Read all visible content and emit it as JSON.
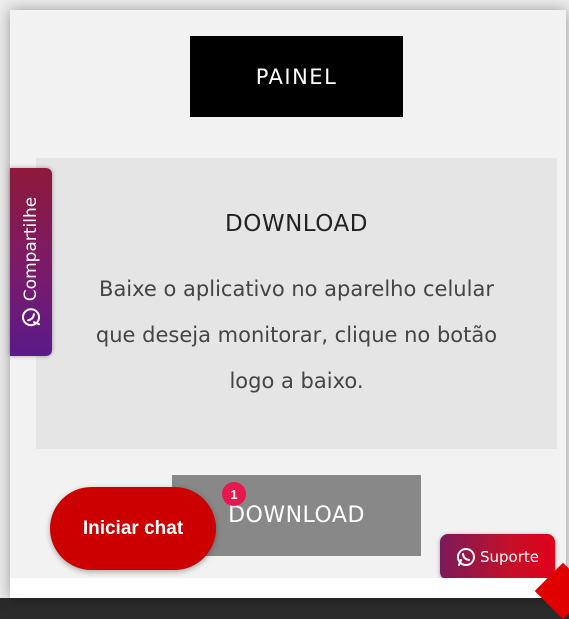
{
  "painel": {
    "label": "PAINEL"
  },
  "card": {
    "title": "DOWNLOAD",
    "text": "Baixe o aplicativo no aparelho celular que deseja monitorar, clique no botão logo a baixo."
  },
  "download_button": {
    "label": "DOWNLOAD"
  },
  "share_tab": {
    "label": "Compartilhe",
    "icon": "whatsapp-icon"
  },
  "chat": {
    "label": "Iniciar chat",
    "badge_count": "1"
  },
  "support": {
    "label": "Suporte",
    "icon": "whatsapp-icon"
  },
  "colors": {
    "chat_red": "#cc0000",
    "badge_pink": "#e8184f",
    "painel_black": "#000000",
    "download_gray": "#888888"
  }
}
